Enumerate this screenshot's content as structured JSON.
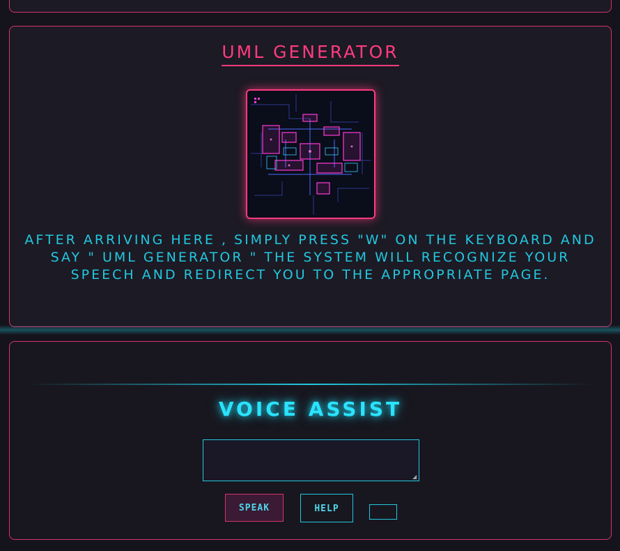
{
  "uml": {
    "title": "UML GENERATOR",
    "image_alt": "Neon UML diagram",
    "instructions": "AFTER ARRIVING HERE , SIMPLY PRESS \"W\" ON THE KEYBOARD AND SAY \" UML GENERATOR \" THE SYSTEM WILL RECOGNIZE YOUR SPEECH AND REDIRECT YOU TO THE APPROPRIATE PAGE."
  },
  "voice": {
    "title": "VOICE ASSIST",
    "input_value": "",
    "speak_label": "SPEAK",
    "help_label": "HELP",
    "extra_label": ""
  },
  "colors": {
    "accent_pink": "#ff3b7f",
    "accent_cyan": "#22c8e0",
    "background": "#15141c"
  }
}
